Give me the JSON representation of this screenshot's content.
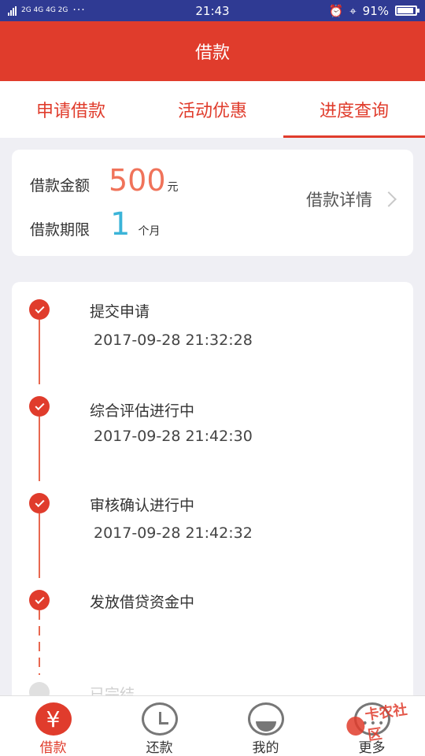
{
  "status_bar": {
    "network": "2G 4G 4G 2G",
    "more": "···",
    "time": "21:43",
    "battery_pct": "91%",
    "battery_level": 0.91,
    "icons": [
      "signal-icon",
      "alarm-icon",
      "location-icon",
      "battery-icon"
    ]
  },
  "header": {
    "title": "借款"
  },
  "tabs": [
    {
      "label": "申请借款",
      "active": false
    },
    {
      "label": "活动优惠",
      "active": false
    },
    {
      "label": "进度查询",
      "active": true
    }
  ],
  "summary": {
    "amount_label": "借款金额",
    "amount_value": "500",
    "amount_unit": "元",
    "term_label": "借款期限",
    "term_value": "1",
    "term_unit": "个月",
    "detail_link": "借款详情"
  },
  "timeline": {
    "steps": [
      {
        "title": "提交申请",
        "time": "2017-09-28 21:32:28",
        "done": true
      },
      {
        "title": "综合评估进行中",
        "time": "2017-09-28 21:42:30",
        "done": true
      },
      {
        "title": "审核确认进行中",
        "time": "2017-09-28 21:42:32",
        "done": true
      },
      {
        "title": "发放借贷资金中",
        "time": "",
        "done": true
      },
      {
        "title": "已完结",
        "time": "",
        "done": false
      }
    ]
  },
  "bottom_nav": [
    {
      "label": "借款",
      "icon": "yuan-icon",
      "active": true
    },
    {
      "label": "还款",
      "icon": "clock-icon",
      "active": false
    },
    {
      "label": "我的",
      "icon": "profile-icon",
      "active": false
    },
    {
      "label": "更多",
      "icon": "more-icon",
      "active": false
    }
  ],
  "watermark": {
    "text": "卡农社区"
  },
  "colors": {
    "primary": "#e03c2c",
    "amount": "#f0735a",
    "term": "#3bb4d8",
    "status_bar": "#2f3a93",
    "background": "#efeff4"
  }
}
